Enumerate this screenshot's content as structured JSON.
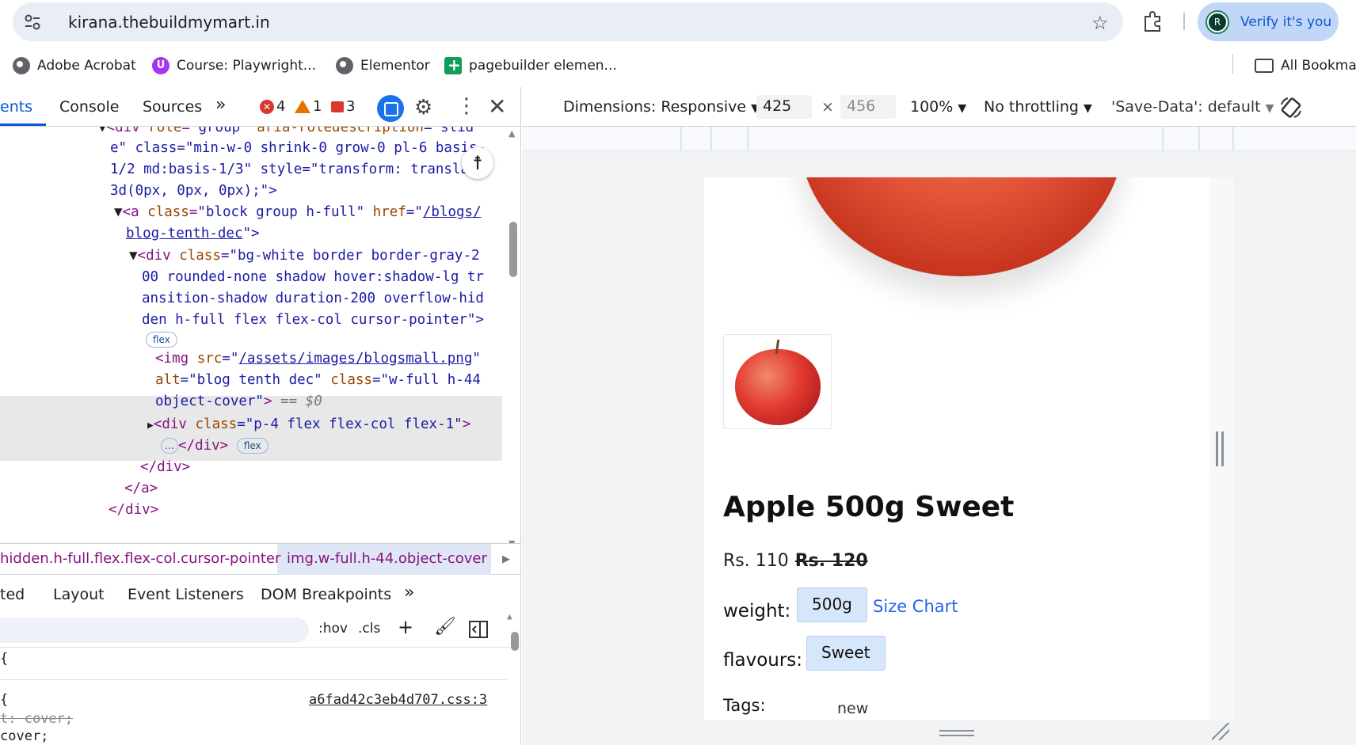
{
  "browser": {
    "url": "kirana.thebuildmymart.in",
    "profile_initial": "R",
    "verify_label": "Verify it's you"
  },
  "bookmarks": [
    {
      "label": "Adobe Acrobat",
      "icon": "globe-icon"
    },
    {
      "label": "Course: Playwright...",
      "icon": "udemy-icon"
    },
    {
      "label": "Elementor",
      "icon": "globe-icon"
    },
    {
      "label": "pagebuilder elemen...",
      "icon": "sheets-icon"
    }
  ],
  "all_bookmarks_label": "All Bookma",
  "devtools": {
    "tabs": [
      "ents",
      "Console",
      "Sources",
      "»"
    ],
    "counts": {
      "errors": "4",
      "warnings": "1",
      "issues": "3"
    },
    "code": {
      "l1": {
        "pre": "▼",
        "tag": "<div ",
        "a1": "role",
        "v1": "\"group\"",
        "a2": " aria-roledescription",
        "v2": "=\"slid"
      },
      "l2": "e\" class=\"min-w-0 shrink-0 grow-0 pl-6 basis-",
      "l3": "1/2 md:basis-1/3\" style=\"transform: translate",
      "l4": "3d(0px, 0px, 0px);\">",
      "l5": {
        "tag": "<a ",
        "attr": "class",
        "val": "\"block group h-full\"",
        "attr2": " href",
        "eq": "=\"",
        "link": "/blogs/"
      },
      "l6": {
        "link": "blog-tenth-dec",
        "end": "\">"
      },
      "l7": {
        "tag": "<div ",
        "attr": "class",
        "val": "=\"bg-white border border-gray-2"
      },
      "l8": "00 rounded-none shadow hover:shadow-lg tr",
      "l9": "ansition-shadow duration-200 overflow-hid",
      "l10": "den h-full flex flex-col cursor-pointer\">",
      "pill_flex": "flex",
      "l11": {
        "tag": "<img ",
        "attr": "src",
        "eq": "=\"",
        "link": "/assets/images/blogsmall.png",
        "end": "\""
      },
      "l12": {
        "attr": "alt",
        "val": "=\"blog tenth dec\"",
        "attr2": " class",
        "val2": "=\"w-full h-44"
      },
      "l13": {
        "val": "object-cover\"",
        "tag": ">",
        "suffix": " == $0"
      },
      "l14": {
        "tag": "<div ",
        "attr": "class",
        "val": "=\"p-4 flex flex-col flex-1\"",
        "end": ">"
      },
      "l15": {
        "ell": "…",
        "tag": "</div>"
      },
      "l16": "</div>",
      "l17": "</a>",
      "l18": "</div>"
    },
    "breadcrumbs": [
      "hidden.h-full.flex.flex-col.cursor-pointer",
      "img.w-full.h-44.object-cover"
    ],
    "sub_tabs": [
      "ted",
      "Layout",
      "Event Listeners",
      "DOM Breakpoints",
      "»"
    ],
    "filter_tools": [
      ":hov",
      ".cls"
    ],
    "styles": {
      "brace1": "{",
      "brace2": "{",
      "source": "a6fad42c3eb4d707.css:3",
      "rule1": "t: cover;",
      "rule2": "cover;"
    }
  },
  "device_toolbar": {
    "dimensions": "Dimensions: Responsive",
    "width": "425",
    "times": "×",
    "height": "456",
    "zoom": "100%",
    "throttling": "No throttling",
    "save_data": "'Save-Data': default"
  },
  "product": {
    "title": "Apple 500g Sweet",
    "price_current": "Rs. 110",
    "price_old": "Rs. 120",
    "weight_label": "weight:",
    "weight_value": "500g",
    "size_chart": "Size Chart",
    "flavours_label": "flavours:",
    "flavours_value": "Sweet",
    "tags_label": "Tags:",
    "tags_value": "new"
  }
}
